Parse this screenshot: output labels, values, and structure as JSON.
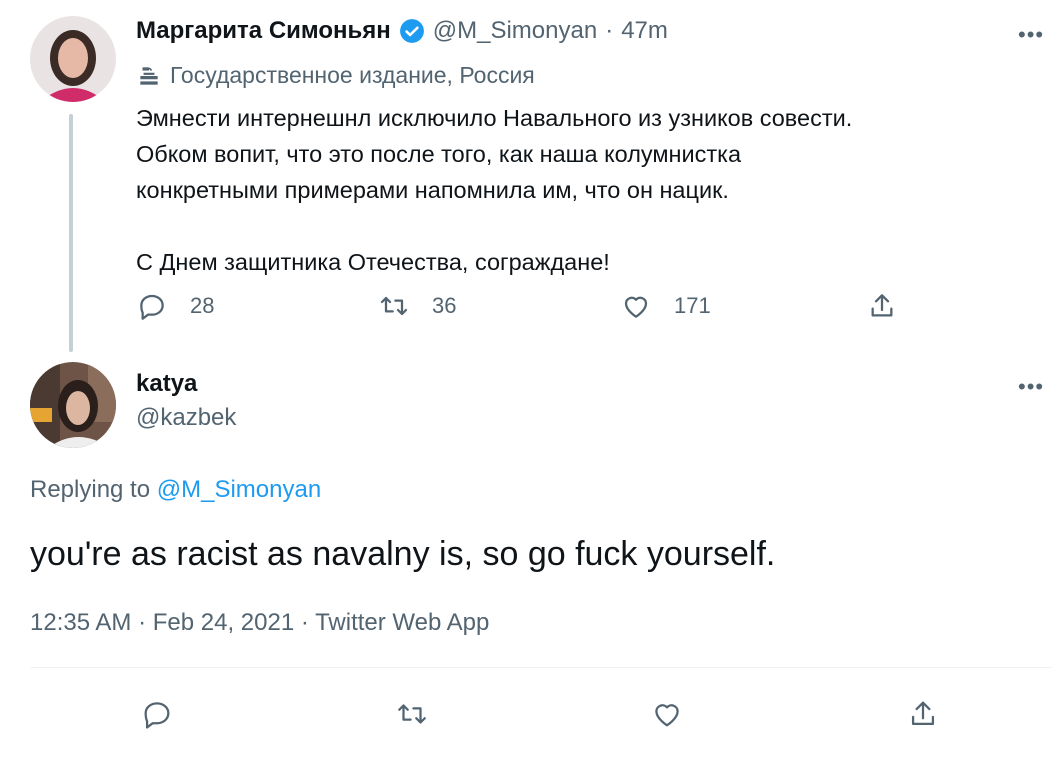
{
  "tweet1": {
    "display_name": "Маргарита Симоньян",
    "handle": "@M_Simonyan",
    "separator": "·",
    "time": "47m",
    "affiliation": "Государственное издание, Россия",
    "text": "Эмнести интернешнл исключило Навального из узников совести.\nОбком вопит, что это после того, как наша колумнистка\nконкретными примерами напомнила им, что он нацик.\n\nС Днем защитника Отечества, сограждане!",
    "reply_count": "28",
    "retweet_count": "36",
    "like_count": "171"
  },
  "tweet2": {
    "display_name": "katya",
    "handle": "@kazbek",
    "replying_prefix": "Replying to",
    "replying_handle": "@M_Simonyan",
    "text": "you're as racist as navalny is, so go fuck yourself.",
    "timestamp": "12:35 AM · Feb 24, 2021 · Twitter Web App"
  },
  "more_label": "•••",
  "colors": {
    "verified": "#1d9bf0",
    "link": "#1d9bf0",
    "secondary_text": "#536471",
    "divider": "#eff3f4"
  },
  "icons": [
    "verified-badge-icon",
    "gov-label-icon",
    "reply-icon",
    "retweet-icon",
    "like-icon",
    "share-icon",
    "more-icon"
  ]
}
